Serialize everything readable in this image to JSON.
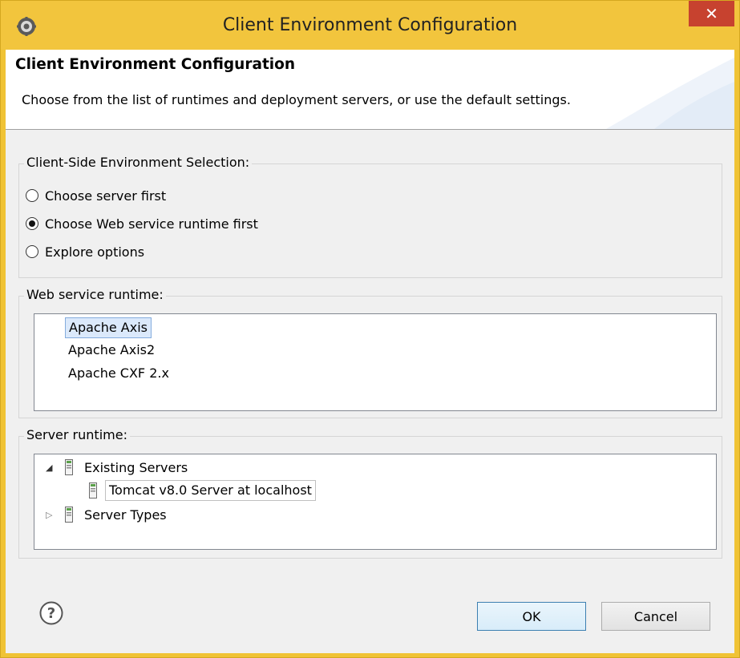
{
  "window": {
    "title": "Client Environment Configuration",
    "close_label": "✕"
  },
  "banner": {
    "title": "Client Environment Configuration",
    "description": "Choose from the list of runtimes and deployment servers, or use the default settings."
  },
  "environment_selection": {
    "label": "Client-Side Environment Selection:",
    "options": [
      {
        "label": "Choose server first",
        "checked": false
      },
      {
        "label": "Choose Web service runtime first",
        "checked": true
      },
      {
        "label": "Explore options",
        "checked": false
      }
    ]
  },
  "web_service_runtime": {
    "label": "Web service runtime:",
    "items": [
      "Apache Axis",
      "Apache Axis2",
      "Apache CXF 2.x"
    ],
    "selected": "Apache Axis"
  },
  "server_runtime": {
    "label": "Server runtime:",
    "tree": [
      {
        "label": "Existing Servers",
        "expanded": true,
        "children": [
          "Tomcat v8.0 Server at localhost"
        ]
      },
      {
        "label": "Server Types",
        "expanded": false
      }
    ]
  },
  "buttons": {
    "ok": "OK",
    "cancel": "Cancel"
  },
  "icons": {
    "app": "eclipse-gear-icon",
    "help": "question-icon",
    "server": "server-icon"
  },
  "colors": {
    "titlebar": "#f2c53d",
    "close": "#c7422f",
    "selection": "#dbe9fb"
  }
}
